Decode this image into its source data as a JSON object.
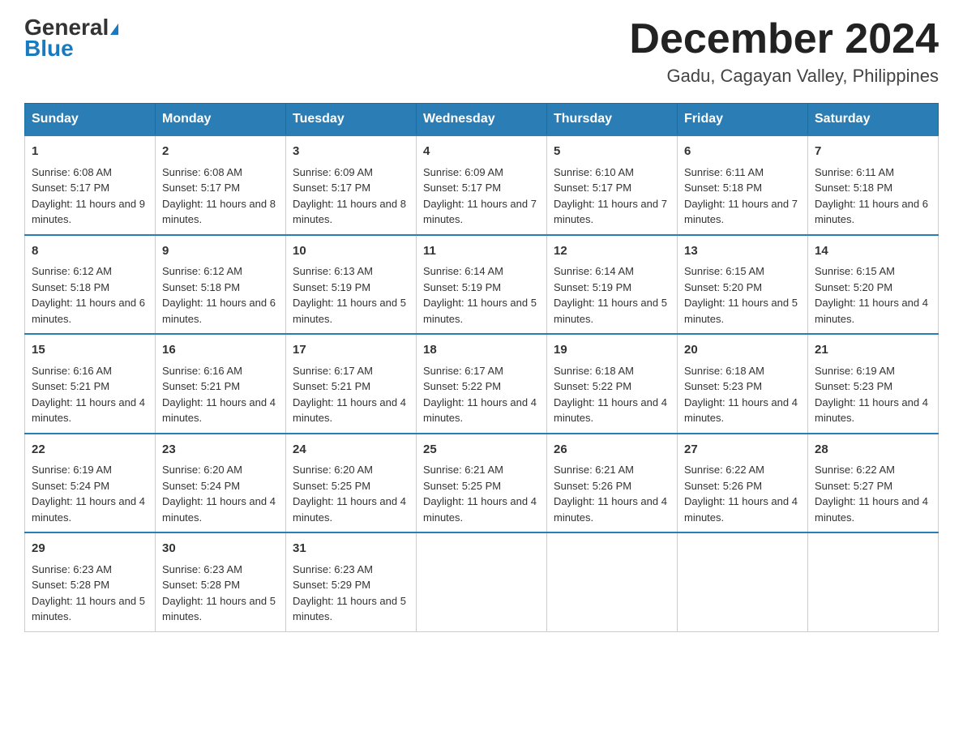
{
  "header": {
    "logo_line1": "General",
    "logo_line2": "Blue",
    "title": "December 2024",
    "subtitle": "Gadu, Cagayan Valley, Philippines"
  },
  "weekdays": [
    "Sunday",
    "Monday",
    "Tuesday",
    "Wednesday",
    "Thursday",
    "Friday",
    "Saturday"
  ],
  "weeks": [
    [
      {
        "day": "1",
        "sunrise": "6:08 AM",
        "sunset": "5:17 PM",
        "daylight": "11 hours and 9 minutes."
      },
      {
        "day": "2",
        "sunrise": "6:08 AM",
        "sunset": "5:17 PM",
        "daylight": "11 hours and 8 minutes."
      },
      {
        "day": "3",
        "sunrise": "6:09 AM",
        "sunset": "5:17 PM",
        "daylight": "11 hours and 8 minutes."
      },
      {
        "day": "4",
        "sunrise": "6:09 AM",
        "sunset": "5:17 PM",
        "daylight": "11 hours and 7 minutes."
      },
      {
        "day": "5",
        "sunrise": "6:10 AM",
        "sunset": "5:17 PM",
        "daylight": "11 hours and 7 minutes."
      },
      {
        "day": "6",
        "sunrise": "6:11 AM",
        "sunset": "5:18 PM",
        "daylight": "11 hours and 7 minutes."
      },
      {
        "day": "7",
        "sunrise": "6:11 AM",
        "sunset": "5:18 PM",
        "daylight": "11 hours and 6 minutes."
      }
    ],
    [
      {
        "day": "8",
        "sunrise": "6:12 AM",
        "sunset": "5:18 PM",
        "daylight": "11 hours and 6 minutes."
      },
      {
        "day": "9",
        "sunrise": "6:12 AM",
        "sunset": "5:18 PM",
        "daylight": "11 hours and 6 minutes."
      },
      {
        "day": "10",
        "sunrise": "6:13 AM",
        "sunset": "5:19 PM",
        "daylight": "11 hours and 5 minutes."
      },
      {
        "day": "11",
        "sunrise": "6:14 AM",
        "sunset": "5:19 PM",
        "daylight": "11 hours and 5 minutes."
      },
      {
        "day": "12",
        "sunrise": "6:14 AM",
        "sunset": "5:19 PM",
        "daylight": "11 hours and 5 minutes."
      },
      {
        "day": "13",
        "sunrise": "6:15 AM",
        "sunset": "5:20 PM",
        "daylight": "11 hours and 5 minutes."
      },
      {
        "day": "14",
        "sunrise": "6:15 AM",
        "sunset": "5:20 PM",
        "daylight": "11 hours and 4 minutes."
      }
    ],
    [
      {
        "day": "15",
        "sunrise": "6:16 AM",
        "sunset": "5:21 PM",
        "daylight": "11 hours and 4 minutes."
      },
      {
        "day": "16",
        "sunrise": "6:16 AM",
        "sunset": "5:21 PM",
        "daylight": "11 hours and 4 minutes."
      },
      {
        "day": "17",
        "sunrise": "6:17 AM",
        "sunset": "5:21 PM",
        "daylight": "11 hours and 4 minutes."
      },
      {
        "day": "18",
        "sunrise": "6:17 AM",
        "sunset": "5:22 PM",
        "daylight": "11 hours and 4 minutes."
      },
      {
        "day": "19",
        "sunrise": "6:18 AM",
        "sunset": "5:22 PM",
        "daylight": "11 hours and 4 minutes."
      },
      {
        "day": "20",
        "sunrise": "6:18 AM",
        "sunset": "5:23 PM",
        "daylight": "11 hours and 4 minutes."
      },
      {
        "day": "21",
        "sunrise": "6:19 AM",
        "sunset": "5:23 PM",
        "daylight": "11 hours and 4 minutes."
      }
    ],
    [
      {
        "day": "22",
        "sunrise": "6:19 AM",
        "sunset": "5:24 PM",
        "daylight": "11 hours and 4 minutes."
      },
      {
        "day": "23",
        "sunrise": "6:20 AM",
        "sunset": "5:24 PM",
        "daylight": "11 hours and 4 minutes."
      },
      {
        "day": "24",
        "sunrise": "6:20 AM",
        "sunset": "5:25 PM",
        "daylight": "11 hours and 4 minutes."
      },
      {
        "day": "25",
        "sunrise": "6:21 AM",
        "sunset": "5:25 PM",
        "daylight": "11 hours and 4 minutes."
      },
      {
        "day": "26",
        "sunrise": "6:21 AM",
        "sunset": "5:26 PM",
        "daylight": "11 hours and 4 minutes."
      },
      {
        "day": "27",
        "sunrise": "6:22 AM",
        "sunset": "5:26 PM",
        "daylight": "11 hours and 4 minutes."
      },
      {
        "day": "28",
        "sunrise": "6:22 AM",
        "sunset": "5:27 PM",
        "daylight": "11 hours and 4 minutes."
      }
    ],
    [
      {
        "day": "29",
        "sunrise": "6:23 AM",
        "sunset": "5:28 PM",
        "daylight": "11 hours and 5 minutes."
      },
      {
        "day": "30",
        "sunrise": "6:23 AM",
        "sunset": "5:28 PM",
        "daylight": "11 hours and 5 minutes."
      },
      {
        "day": "31",
        "sunrise": "6:23 AM",
        "sunset": "5:29 PM",
        "daylight": "11 hours and 5 minutes."
      },
      null,
      null,
      null,
      null
    ]
  ]
}
